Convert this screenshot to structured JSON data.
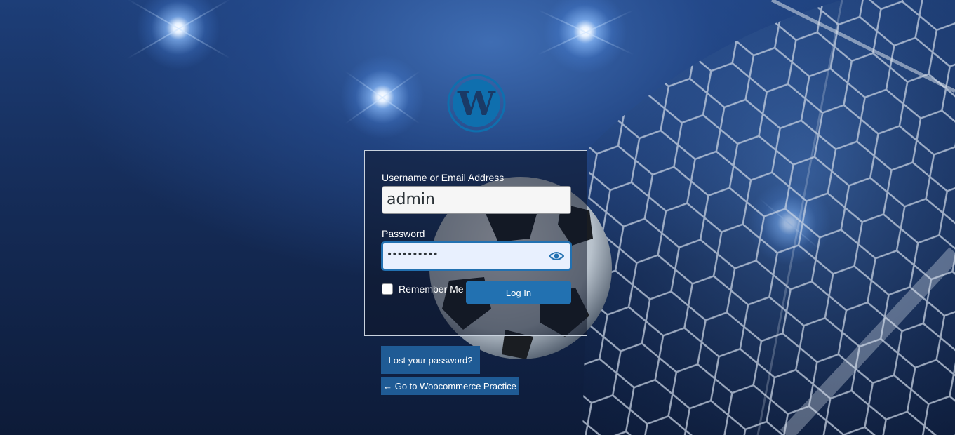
{
  "logo": {
    "icon": "wordpress-logo-icon",
    "color": "#0f6fae"
  },
  "form": {
    "username_label": "Username or Email Address",
    "username_value": "admin",
    "password_label": "Password",
    "password_value": "••••••••••",
    "show_password_icon": "eye-icon",
    "remember_label": "Remember Me",
    "login_button": "Log In"
  },
  "links": {
    "lost_password": "Lost your password?",
    "back_to_site": "← Go to Woocommerce Practice"
  },
  "colors": {
    "accent": "#2271b1",
    "link_bg": "#1f5b95",
    "field_focus_bg": "#e8f0fe"
  }
}
